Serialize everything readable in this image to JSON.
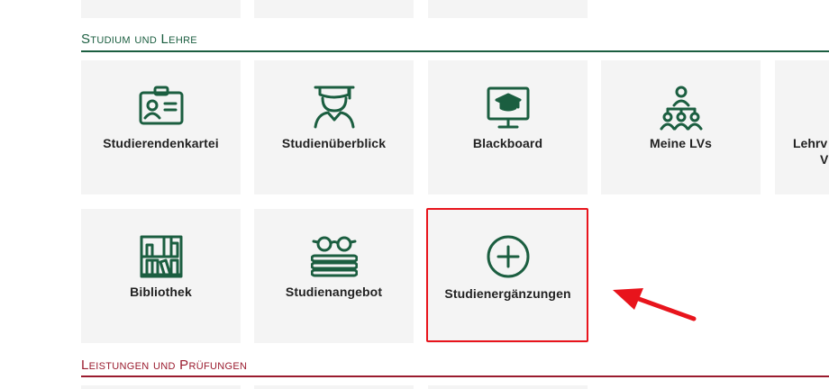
{
  "sections": {
    "studium": {
      "title": "Studium und Lehre",
      "color": "#1b5e40"
    },
    "leistungen": {
      "title": "Leistungen und Prüfungen",
      "color": "#9a1b2e"
    }
  },
  "tiles": {
    "studierendenkartei": {
      "label": "Studierendenkartei",
      "icon": "id-card-icon"
    },
    "studienueberblick": {
      "label": "Studienüberblick",
      "icon": "graduate-icon"
    },
    "blackboard": {
      "label": "Blackboard",
      "icon": "monitor-graduation-cap-icon"
    },
    "meine_lvs": {
      "label": "Meine LVs",
      "icon": "group-hierarchy-icon"
    },
    "lehrveranstaltungen": {
      "label": "Lehrv",
      "label2": "V",
      "icon": "partial-tile"
    },
    "bibliothek": {
      "label": "Bibliothek",
      "icon": "bookshelf-icon"
    },
    "studienangebot": {
      "label": "Studienangebot",
      "icon": "glasses-books-icon"
    },
    "studienergaenzungen": {
      "label": "Studienergänzungen",
      "icon": "plus-circle-icon"
    }
  },
  "annotation": {
    "highlight_color": "#e8141c",
    "arrow": "red-arrow-pointing-left"
  }
}
